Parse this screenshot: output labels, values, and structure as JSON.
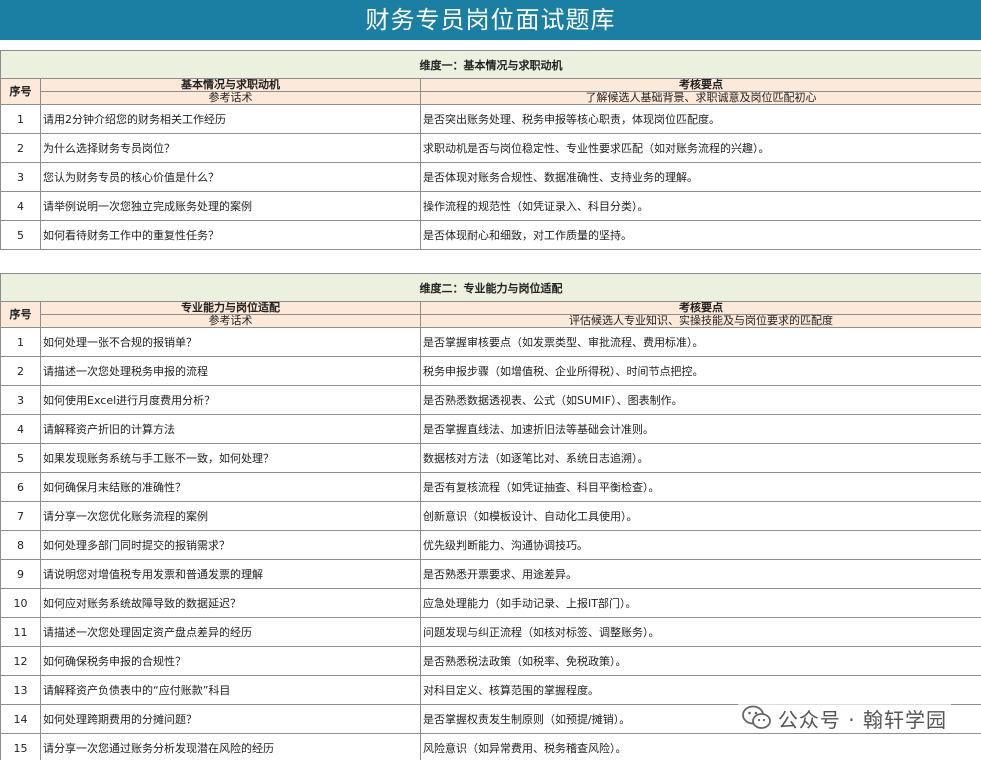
{
  "title": "财务专员岗位面试题库",
  "seq_header": "序号",
  "section1": {
    "dimension": "维度一：基本情况与求职动机",
    "col_left_title": "基本情况与求职动机",
    "col_left_sub": "参考话术",
    "col_right_title": "考核要点",
    "col_right_sub": "了解候选人基础背景、求职诚意及岗位匹配初心",
    "rows": [
      {
        "n": "1",
        "q": "请用2分钟介绍您的财务相关工作经历",
        "a": "是否突出账务处理、税务申报等核心职责，体现岗位匹配度。"
      },
      {
        "n": "2",
        "q": "为什么选择财务专员岗位？",
        "a": "求职动机是否与岗位稳定性、专业性要求匹配（如对账务流程的兴趣）。"
      },
      {
        "n": "3",
        "q": "您认为财务专员的核心价值是什么？",
        "a": "是否体现对账务合规性、数据准确性、支持业务的理解。"
      },
      {
        "n": "4",
        "q": "请举例说明一次您独立完成账务处理的案例",
        "a": "操作流程的规范性（如凭证录入、科目分类）。"
      },
      {
        "n": "5",
        "q": "如何看待财务工作中的重复性任务？",
        "a": "是否体现耐心和细致，对工作质量的坚持。"
      }
    ]
  },
  "section2": {
    "dimension": "维度二：专业能力与岗位适配",
    "col_left_title": "专业能力与岗位适配",
    "col_left_sub": "参考话术",
    "col_right_title": "考核要点",
    "col_right_sub": "评估候选人专业知识、实操技能及与岗位要求的匹配度",
    "rows": [
      {
        "n": "1",
        "q": "如何处理一张不合规的报销单？",
        "a": "是否掌握审核要点（如发票类型、审批流程、费用标准）。"
      },
      {
        "n": "2",
        "q": "请描述一次您处理税务申报的流程",
        "a": "税务申报步骤（如增值税、企业所得税）、时间节点把控。"
      },
      {
        "n": "3",
        "q": "如何使用Excel进行月度费用分析？",
        "a": "是否熟悉数据透视表、公式（如SUMIF）、图表制作。"
      },
      {
        "n": "4",
        "q": "请解释资产折旧的计算方法",
        "a": "是否掌握直线法、加速折旧法等基础会计准则。"
      },
      {
        "n": "5",
        "q": "如果发现账务系统与手工账不一致，如何处理？",
        "a": "数据核对方法（如逐笔比对、系统日志追溯）。"
      },
      {
        "n": "6",
        "q": "如何确保月末结账的准确性？",
        "a": "是否有复核流程（如凭证抽查、科目平衡检查）。"
      },
      {
        "n": "7",
        "q": "请分享一次您优化账务流程的案例",
        "a": "创新意识（如模板设计、自动化工具使用）。"
      },
      {
        "n": "8",
        "q": "如何处理多部门同时提交的报销需求？",
        "a": "优先级判断能力、沟通协调技巧。"
      },
      {
        "n": "9",
        "q": "请说明您对增值税专用发票和普通发票的理解",
        "a": "是否熟悉开票要求、用途差异。"
      },
      {
        "n": "10",
        "q": "如何应对账务系统故障导致的数据延迟？",
        "a": "应急处理能力（如手动记录、上报IT部门）。"
      },
      {
        "n": "11",
        "q": "请描述一次您处理固定资产盘点差异的经历",
        "a": "问题发现与纠正流程（如核对标签、调整账务）。"
      },
      {
        "n": "12",
        "q": "如何确保税务申报的合规性？",
        "a": "是否熟悉税法政策（如税率、免税政策）。"
      },
      {
        "n": "13",
        "q": "请解释资产负债表中的“应付账款”科目",
        "a": "对科目定义、核算范围的掌握程度。"
      },
      {
        "n": "14",
        "q": "如何处理跨期费用的分摊问题？",
        "a": "是否掌握权责发生制原则（如预提/摊销）。"
      },
      {
        "n": "15",
        "q": "请分享一次您通过账务分析发现潜在风险的经历",
        "a": "风险意识（如异常费用、税务稽查风险）。"
      }
    ]
  },
  "watermark": {
    "text": "公众号 · 翰轩学园",
    "icon": "wechat-icon"
  }
}
